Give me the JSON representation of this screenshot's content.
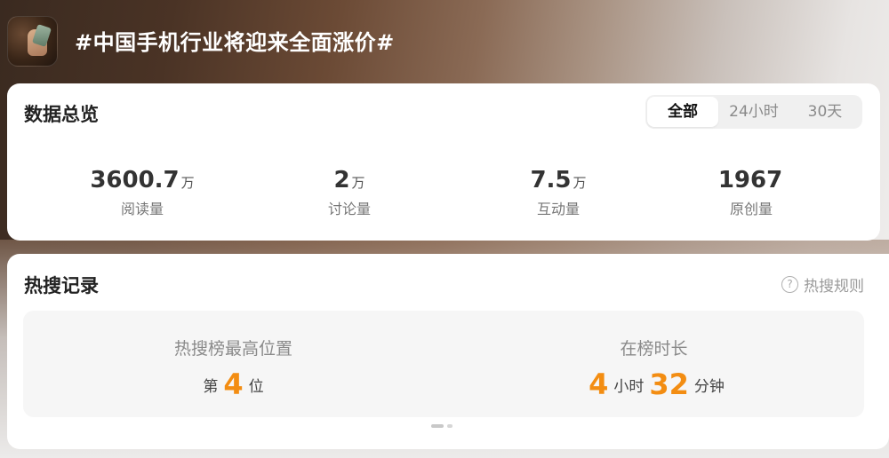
{
  "topic": {
    "title": "#中国手机行业将迎来全面涨价#",
    "thumbnail_icon": "hand-holding-phone-thumbnail"
  },
  "overview": {
    "title": "数据总览",
    "tabs": [
      {
        "label": "全部",
        "active": true
      },
      {
        "label": "24小时",
        "active": false
      },
      {
        "label": "30天",
        "active": false
      }
    ],
    "stats": [
      {
        "value": "3600.7",
        "unit": "万",
        "label": "阅读量"
      },
      {
        "value": "2",
        "unit": "万",
        "label": "讨论量"
      },
      {
        "value": "7.5",
        "unit": "万",
        "label": "互动量"
      },
      {
        "value": "1967",
        "unit": "",
        "label": "原创量"
      }
    ]
  },
  "hot_search": {
    "title": "热搜记录",
    "rules_label": "热搜规则",
    "rules_icon": "question-circle-icon",
    "highest_rank": {
      "label": "热搜榜最高位置",
      "prefix": "第",
      "value": "4",
      "suffix": "位"
    },
    "duration": {
      "label": "在榜时长",
      "hours": "4",
      "hours_unit": "小时",
      "minutes": "32",
      "minutes_unit": "分钟"
    },
    "pager": {
      "pages": 2,
      "active_index": 0
    }
  },
  "colors": {
    "accent_orange": "#f38d12",
    "card_bg": "#ffffff",
    "panel_bg": "#f6f6f6"
  }
}
